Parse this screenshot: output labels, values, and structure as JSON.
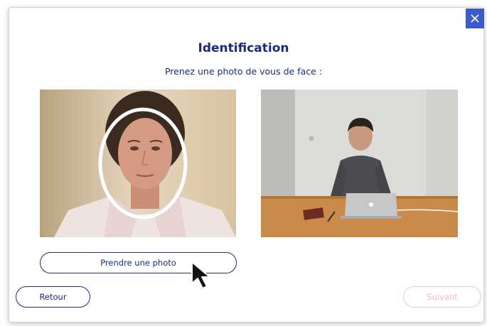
{
  "dialog": {
    "title": "Identification",
    "subtitle": "Prenez une photo de vous de face :",
    "close_icon": "close-icon"
  },
  "left_photo": {
    "kind": "webcam-selfie",
    "overlay": "face-oval-guide"
  },
  "right_photo": {
    "kind": "example-person-at-laptop"
  },
  "buttons": {
    "take_photo_label": "Prendre une photo",
    "back_label": "Retour",
    "next_label": "Suivant",
    "next_enabled": false
  },
  "colors": {
    "primary": "#1d2a7b",
    "close_bg": "#3b5cc9",
    "disabled": "#f2b9c3"
  }
}
